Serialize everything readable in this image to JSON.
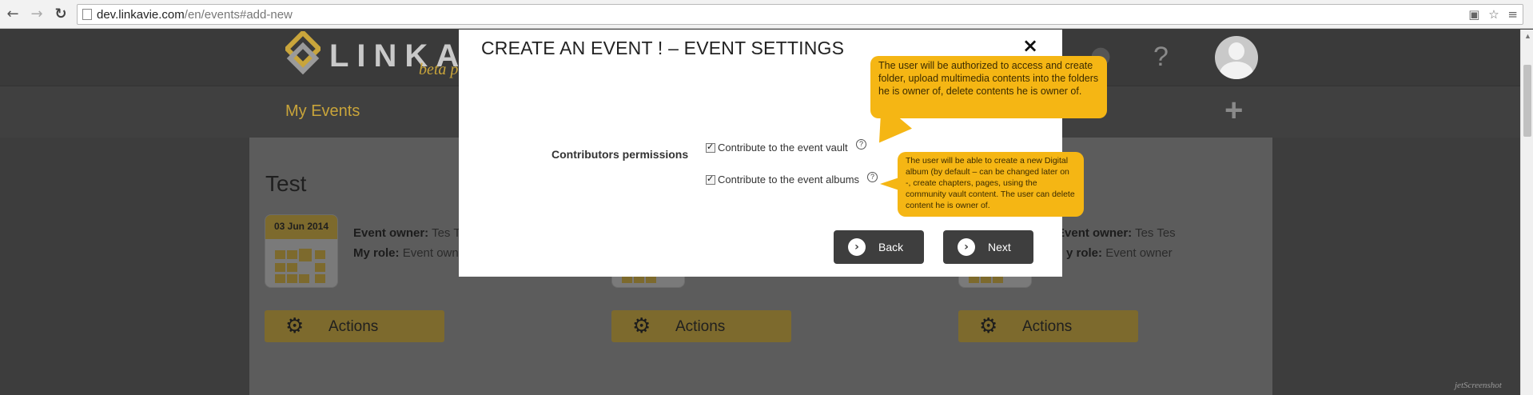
{
  "browser": {
    "url_host": "dev.linkavie.com",
    "url_path": "/en/events#add-new"
  },
  "header": {
    "logo_text": "LINKAV",
    "logo_beta": "beta pr",
    "help_label": "?"
  },
  "subnav": {
    "my_events": "My Events",
    "add_label": "+"
  },
  "page": {
    "title": "Test",
    "events": [
      {
        "date": "03 Jun 2014",
        "owner_label": "Event owner:",
        "owner_value": "Tes T",
        "role_label": "My role:",
        "role_value": "Event own",
        "actions_label": "Actions"
      },
      {
        "actions_label": "Actions"
      },
      {
        "owner_label": "Event owner:",
        "owner_value": "Tes Tes",
        "role_label": "y role:",
        "role_value": "Event owner",
        "actions_label": "Actions"
      }
    ]
  },
  "modal": {
    "title": "CREATE AN EVENT ! – EVENT SETTINGS",
    "close_label": "×",
    "permissions_label": "Contributors permissions",
    "options": [
      {
        "label": "Contribute to the event vault",
        "checked": true
      },
      {
        "label": "Contribute to the event albums",
        "checked": true
      }
    ],
    "help_glyph": "?",
    "tooltip_vault": "The user will be authorized to access and create folder, upload multimedia contents into the folders he is owner of, delete contents he is owner of.",
    "tooltip_albums": "The user will be able to create a new Digital album (by default – can be changed later on -, create chapters, pages, using the community vault content. The user can delete content he is owner of.",
    "back_label": "Back",
    "next_label": "Next"
  },
  "watermark": "jetScreenshot",
  "colors": {
    "accent_gold": "#c9a53b",
    "tooltip_yellow": "#f5b614",
    "button_dark": "#3e3e3e"
  }
}
